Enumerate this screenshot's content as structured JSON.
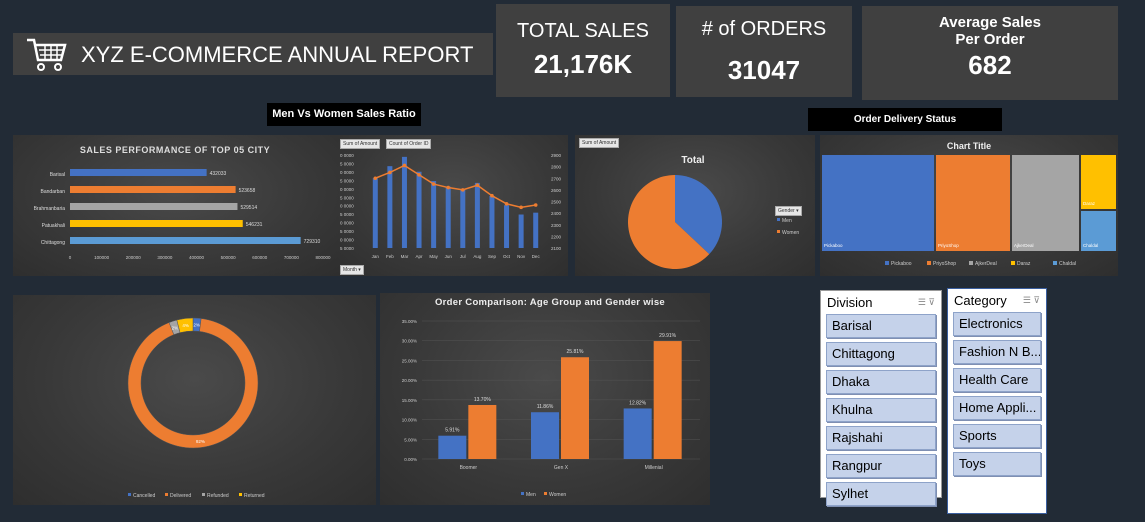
{
  "header": {
    "title": "XYZ E-COMMERCE ANNUAL REPORT",
    "cart_icon": "shopping-cart-icon"
  },
  "kpis": {
    "total_sales": {
      "label": "TOTAL SALES",
      "value": "21,176K"
    },
    "orders": {
      "label": "# of ORDERS",
      "value": "31047"
    },
    "avg": {
      "label1": "Average Sales",
      "label2": "Per Order",
      "value": "682"
    }
  },
  "section_labels": {
    "men_women": "Men Vs Women Sales Ratio",
    "delivery": "Order Delivery Status"
  },
  "chart_data": [
    {
      "id": "city",
      "type": "bar",
      "title": "SALES PERFORMANCE OF TOP 05 CITY",
      "categories": [
        "Barisal",
        "Bandarban",
        "Brahmanbaria",
        "Patuakhali",
        "Chittagong"
      ],
      "values": [
        432033,
        523658,
        529514,
        546231,
        729310
      ],
      "colors": [
        "#4472c4",
        "#ed7d31",
        "#a5a5a5",
        "#ffc000",
        "#5b9bd5"
      ],
      "xlim": [
        0,
        800000
      ],
      "xticks": [
        "0",
        "100000",
        "200000",
        "300000",
        "400000",
        "500000",
        "600000",
        "700000",
        "800000"
      ]
    },
    {
      "id": "monthly",
      "type": "bar+line",
      "pill_labels": [
        "Sum of Amount",
        "Count of Order ID"
      ],
      "filter_label": "Month",
      "categories": [
        "Jan",
        "Feb",
        "Mar",
        "Apr",
        "May",
        "Jun",
        "Jul",
        "Aug",
        "Sep",
        "Oct",
        "Nov",
        "Dec"
      ],
      "bars": [
        0.75,
        0.88,
        0.98,
        0.82,
        0.72,
        0.66,
        0.63,
        0.7,
        0.56,
        0.46,
        0.36,
        0.38
      ],
      "line": [
        2700,
        2750,
        2810,
        2730,
        2650,
        2620,
        2600,
        2640,
        2550,
        2480,
        2450,
        2470
      ],
      "left_ticks": [
        "0 0000",
        "5 0000",
        "0 0000",
        "5 0000",
        "0 0000",
        "5 0000",
        "0 0000",
        "5 0000",
        "0 0000",
        "5 0000",
        "0 0000",
        "5 0000"
      ],
      "right_ticks": [
        "2900",
        "2800",
        "2700",
        "2600",
        "2500",
        "2400",
        "2300",
        "2200",
        "2100"
      ],
      "right_ylim": [
        2100,
        2900
      ]
    },
    {
      "id": "gender",
      "type": "pie",
      "title": "Total",
      "pill_label": "Sum of Amount",
      "legend_title": "Gender",
      "slices": [
        {
          "name": "Men",
          "value": 0.37,
          "color": "#4472c4"
        },
        {
          "name": "Women",
          "value": 0.63,
          "color": "#ed7d31"
        }
      ]
    },
    {
      "id": "delivery",
      "type": "treemap",
      "title": "Chart Title",
      "items": [
        {
          "name": "Pickaboo",
          "color": "#4472c4"
        },
        {
          "name": "PriyoShop",
          "color": "#ed7d31"
        },
        {
          "name": "AjkerDeal",
          "color": "#a5a5a5"
        },
        {
          "name": "Daraz",
          "color": "#ffc000"
        },
        {
          "name": "Chaldal",
          "color": "#5b9bd5"
        }
      ]
    },
    {
      "id": "donut",
      "type": "pie",
      "slices": [
        {
          "name": "Cancelled",
          "value": 0.02,
          "color": "#4472c4"
        },
        {
          "name": "Delivered",
          "value": 0.92,
          "color": "#ed7d31"
        },
        {
          "name": "Refunded",
          "value": 0.02,
          "color": "#a5a5a5"
        },
        {
          "name": "Returned",
          "value": 0.04,
          "color": "#ffc000"
        }
      ],
      "labels": [
        "2%",
        "92%",
        "2%",
        "4%"
      ]
    },
    {
      "id": "age",
      "type": "bar",
      "title": "Order Comparison: Age Group and  Gender wise",
      "categories": [
        "Boomer",
        "Gen X",
        "Millenial"
      ],
      "series": [
        {
          "name": "Men",
          "values": [
            5.91,
            11.86,
            12.82
          ],
          "color": "#4472c4"
        },
        {
          "name": "Women",
          "values": [
            13.7,
            25.81,
            29.91
          ],
          "color": "#ed7d31"
        }
      ],
      "value_labels": {
        "Men": [
          "5.91%",
          "11.86%",
          "12.82%"
        ],
        "Women": [
          "13.70%",
          "25.81%",
          "29.91%"
        ]
      },
      "ylim": [
        0,
        35
      ],
      "yticks": [
        "0.00%",
        "5.00%",
        "10.00%",
        "15.00%",
        "20.00%",
        "25.00%",
        "30.00%",
        "35.00%"
      ]
    }
  ],
  "slicers": {
    "division": {
      "title": "Division",
      "items": [
        "Barisal",
        "Chittagong",
        "Dhaka",
        "Khulna",
        "Rajshahi",
        "Rangpur",
        "Sylhet"
      ]
    },
    "category": {
      "title": "Category",
      "items": [
        "Electronics",
        "Fashion N B...",
        "Health Care",
        "Home Appli...",
        "Sports",
        "Toys"
      ]
    }
  }
}
